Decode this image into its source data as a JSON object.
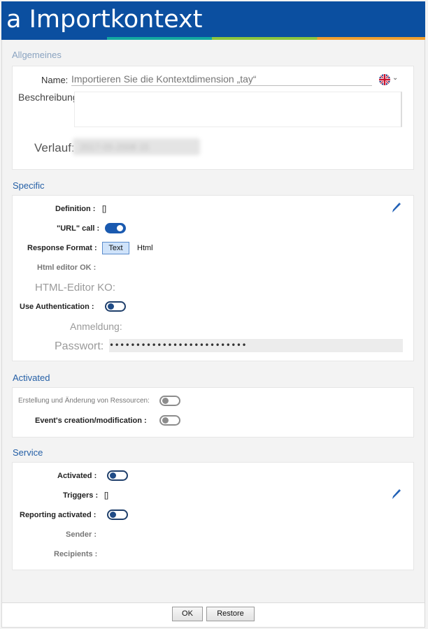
{
  "window": {
    "title": "a Importkontext"
  },
  "general": {
    "section_title": "Allgemeines",
    "name_label": "Name:",
    "name_placeholder": "Importieren Sie die Kontextdimension „tay“",
    "language_icon": "uk-flag-icon",
    "description_label": "Beschreibung:",
    "history_label": "Verlauf:",
    "history_value": "2017-05-2008 15"
  },
  "specific": {
    "section_title": "Specific",
    "definition_label": "Definition :",
    "definition_value": "[]",
    "url_call_label": "\"URL\" call :",
    "url_call_on": true,
    "response_format_label": "Response Format :",
    "format_text": "Text",
    "format_html": "Html",
    "html_ok_label": "Html editor OK :",
    "html_ko_label": "HTML-Editor KO:",
    "use_auth_label": "Use Authentication :",
    "use_auth_on": false,
    "login_label": "Anmeldung:",
    "password_label": "Passwort:",
    "password_value": "••••••••••••••••••••••••••"
  },
  "activated": {
    "section_title": "Activated",
    "resource_label": "Erstellung und Änderung von Ressourcen:",
    "event_label": "Event's creation/modification :"
  },
  "service": {
    "section_title": "Service",
    "activated_label": "Activated :",
    "triggers_label": "Triggers :",
    "triggers_value": "[]",
    "reporting_label": "Reporting activated :",
    "sender_label": "Sender :",
    "recipients_label": "Recipients :"
  },
  "footer": {
    "ok_label": "OK",
    "restore_label": "Restore"
  },
  "colors": {
    "titlebar": "#0b4fa0",
    "accent": "#245fa6",
    "toggle_on": "#1a5ab0"
  }
}
